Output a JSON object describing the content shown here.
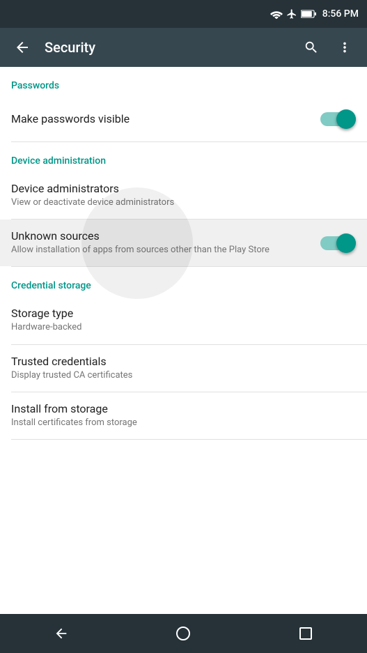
{
  "statusBar": {
    "time": "8:56 PM"
  },
  "appBar": {
    "title": "Security",
    "backLabel": "←",
    "searchLabel": "⌕",
    "moreLabel": "⋮"
  },
  "sections": {
    "passwords": {
      "header": "Passwords",
      "items": [
        {
          "id": "make-passwords-visible",
          "title": "Make passwords visible",
          "subtitle": "",
          "hasToggle": true,
          "toggleOn": true
        }
      ]
    },
    "deviceAdministration": {
      "header": "Device administration",
      "items": [
        {
          "id": "device-administrators",
          "title": "Device administrators",
          "subtitle": "View or deactivate device administrators",
          "hasToggle": false,
          "toggleOn": false
        },
        {
          "id": "unknown-sources",
          "title": "Unknown sources",
          "subtitle": "Allow installation of apps from sources other than the Play Store",
          "hasToggle": true,
          "toggleOn": true,
          "highlighted": true
        }
      ]
    },
    "credentialStorage": {
      "header": "Credential storage",
      "items": [
        {
          "id": "storage-type",
          "title": "Storage type",
          "subtitle": "Hardware-backed",
          "hasToggle": false,
          "toggleOn": false
        },
        {
          "id": "trusted-credentials",
          "title": "Trusted credentials",
          "subtitle": "Display trusted CA certificates",
          "hasToggle": false,
          "toggleOn": false
        },
        {
          "id": "install-from-storage",
          "title": "Install from storage",
          "subtitle": "Install certificates from storage",
          "hasToggle": false,
          "toggleOn": false
        }
      ]
    }
  },
  "colors": {
    "accent": "#009688",
    "sectionHeader": "#009688",
    "appBar": "#37474f",
    "statusBar": "#263238",
    "navBar": "#263238"
  }
}
